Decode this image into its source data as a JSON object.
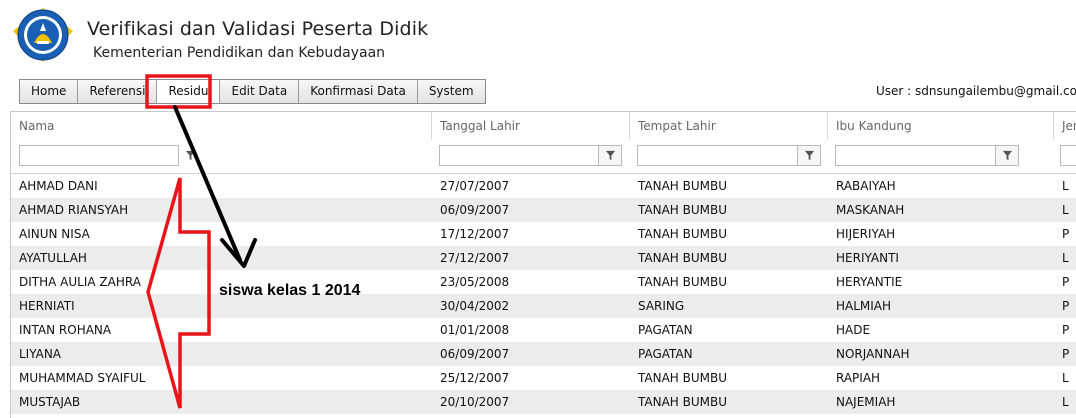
{
  "header": {
    "logo_text": "TUT WURI HANDAYANI",
    "title": "Verifikasi dan Validasi Peserta Didik",
    "subtitle": "Kementerian Pendidikan dan Kebudayaan"
  },
  "menu": {
    "items": [
      "Home",
      "Referensi",
      "Residu",
      "Edit Data",
      "Konfirmasi Data",
      "System"
    ],
    "active": "Residu"
  },
  "user_info": "User : sdnsungailembu@gmail.com, S",
  "table": {
    "columns": [
      "Nama",
      "Tanggal Lahir",
      "Tempat Lahir",
      "Ibu Kandung",
      "Jen"
    ],
    "rows": [
      [
        "AHMAD DANI",
        "27/07/2007",
        "TANAH BUMBU",
        "RABAIYAH",
        "L"
      ],
      [
        "AHMAD RIANSYAH",
        "06/09/2007",
        "TANAH BUMBU",
        "MASKANAH",
        "L"
      ],
      [
        "AINUN NISA",
        "17/12/2007",
        "TANAH BUMBU",
        "HIJERIYAH",
        "P"
      ],
      [
        "AYATULLAH",
        "27/12/2007",
        "TANAH BUMBU",
        "HERIYANTI",
        "L"
      ],
      [
        "DITHA AULIA ZAHRA",
        "23/05/2008",
        "TANAH BUMBU",
        "HERYANTIE",
        "P"
      ],
      [
        "HERNIATI",
        "30/04/2002",
        "SARING",
        "HALMIAH",
        "P"
      ],
      [
        "INTAN ROHANA",
        "01/01/2008",
        "PAGATAN",
        "HADE",
        "P"
      ],
      [
        "LIYANA",
        "06/09/2007",
        "PAGATAN",
        "NORJANNAH",
        "P"
      ],
      [
        "MUHAMMAD SYAIFUL",
        "25/12/2007",
        "TANAH BUMBU",
        "RAPIAH",
        "L"
      ],
      [
        "MUSTAJAB",
        "20/10/2007",
        "TANAH BUMBU",
        "NAJEMIAH",
        "L"
      ]
    ]
  },
  "annotation": {
    "text": "siswa kelas 1 2014",
    "highlight_color": "#e8141a",
    "arrow_color": "#000000"
  },
  "colors": {
    "alt_row": "#ececec",
    "header_text": "#666666",
    "logo_blue": "#1a5fb4"
  }
}
